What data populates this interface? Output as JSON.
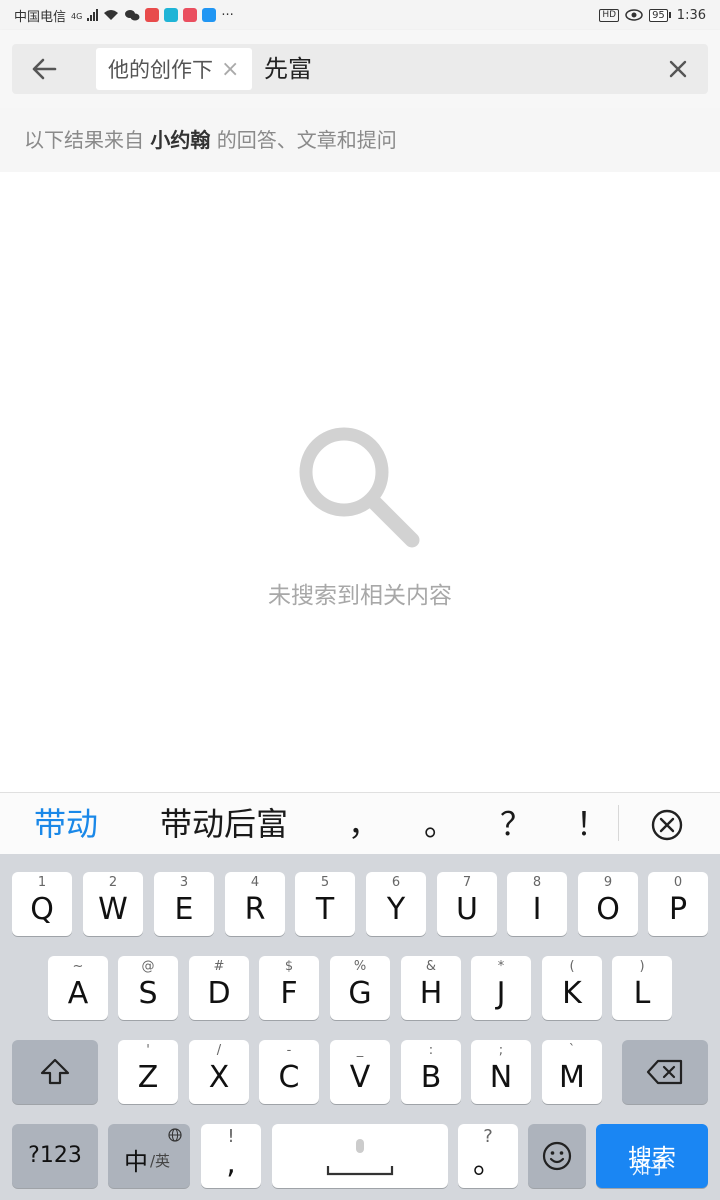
{
  "status_bar": {
    "carrier": "中国电信",
    "network": "4G",
    "dots": "···",
    "hd": "HD",
    "battery": "95",
    "time": "1:36"
  },
  "search": {
    "scope_chip": "他的创作下",
    "chip_close": "×",
    "query": "先富"
  },
  "source_note": {
    "prefix": "以下结果来自",
    "author": "小约翰",
    "suffix": "的回答、文章和提问"
  },
  "empty_state": {
    "message": "未搜索到相关内容"
  },
  "candidates": [
    "带动",
    "带动后富",
    "，",
    "。",
    "？",
    "！"
  ],
  "keyboard": {
    "row1": [
      {
        "sup": "1",
        "main": "Q"
      },
      {
        "sup": "2",
        "main": "W"
      },
      {
        "sup": "3",
        "main": "E"
      },
      {
        "sup": "4",
        "main": "R"
      },
      {
        "sup": "5",
        "main": "T"
      },
      {
        "sup": "6",
        "main": "Y"
      },
      {
        "sup": "7",
        "main": "U"
      },
      {
        "sup": "8",
        "main": "I"
      },
      {
        "sup": "9",
        "main": "O"
      },
      {
        "sup": "0",
        "main": "P"
      }
    ],
    "row2": [
      {
        "sup": "~",
        "main": "A"
      },
      {
        "sup": "@",
        "main": "S"
      },
      {
        "sup": "#",
        "main": "D"
      },
      {
        "sup": "$",
        "main": "F"
      },
      {
        "sup": "%",
        "main": "G"
      },
      {
        "sup": "&",
        "main": "H"
      },
      {
        "sup": "*",
        "main": "J"
      },
      {
        "sup": "(",
        "main": "K"
      },
      {
        "sup": ")",
        "main": "L"
      }
    ],
    "row3": [
      {
        "sup": "'",
        "main": "Z"
      },
      {
        "sup": "/",
        "main": "X"
      },
      {
        "sup": "-",
        "main": "C"
      },
      {
        "sup": "_",
        "main": "V"
      },
      {
        "sup": ":",
        "main": "B"
      },
      {
        "sup": ";",
        "main": "N"
      },
      {
        "sup": "`",
        "main": "M"
      }
    ],
    "symbols_label": "?123",
    "lang_main": "中",
    "lang_sub": "/英",
    "comma_sup": "!",
    "comma_main": ",",
    "period_sup": "?",
    "period_main": "。",
    "search_label": "搜索",
    "watermark": "知乎"
  }
}
